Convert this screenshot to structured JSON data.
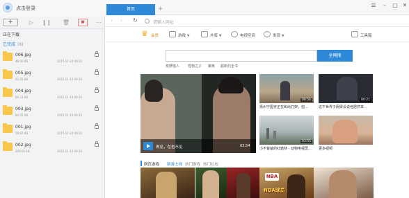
{
  "sidebar": {
    "login_label": "点击登录",
    "section_label": "正在下载",
    "completed_label": "已完成",
    "completed_count": "(6)",
    "files": [
      {
        "name": "006.jpg",
        "size": "48.06 KB",
        "date": "2015-11-10 09:33"
      },
      {
        "name": "005.jpg",
        "size": "63.55 KB",
        "date": "2015-11-10 09:33"
      },
      {
        "name": "004.jpg",
        "size": "60.23 KB",
        "date": "2015-11-10 09:33"
      },
      {
        "name": "003.jpg",
        "size": "84.55 KB",
        "date": "2015-11-10 09:33"
      },
      {
        "name": "001.jpg",
        "size": "59.87 KB",
        "date": "2015-11-10 09:33"
      },
      {
        "name": "002.jpg",
        "size": "209.66 KB",
        "date": "2015-11-10 09:33"
      }
    ]
  },
  "tabs": {
    "home_label": "首页",
    "new_tab": "+"
  },
  "address": {
    "placeholder": "请输入网址"
  },
  "portal": {
    "nav": {
      "member": "会员",
      "games": "游戏",
      "video": "片库",
      "vr_space": "电视空间",
      "discovery": "发现",
      "toolbox": "工具箱"
    },
    "search": {
      "button": "全网搜",
      "hot_links": [
        "荒野猎人",
        "怪物之子",
        "聚焦",
        "超新约全书"
      ]
    },
    "feature": {
      "caption": "再见，在也不见",
      "duration": "03:54"
    },
    "videos": [
      {
        "title": "扬州宁国寺正在和尚打架，但...",
        "duration": "00:56"
      },
      {
        "title": "这下世界子网梁设说他居然来...",
        "duration": "00:21"
      },
      {
        "title": "小不爸爸的红菇林 - 动物电视屏...",
        "duration": "03:55"
      },
      {
        "title": "更多视频",
        "duration": ""
      }
    ],
    "games": {
      "title": "网页游戏",
      "tabs": [
        "新游上线",
        "热门游戏",
        "热门礼包"
      ],
      "nba_badge": "NBA",
      "banner_label": "NBA球员"
    }
  },
  "colors": {
    "accent": "#2e8ad8",
    "sidebar_bg": "#f2f3f5",
    "folder": "#f7c64a",
    "crown": "#f0a91e"
  }
}
